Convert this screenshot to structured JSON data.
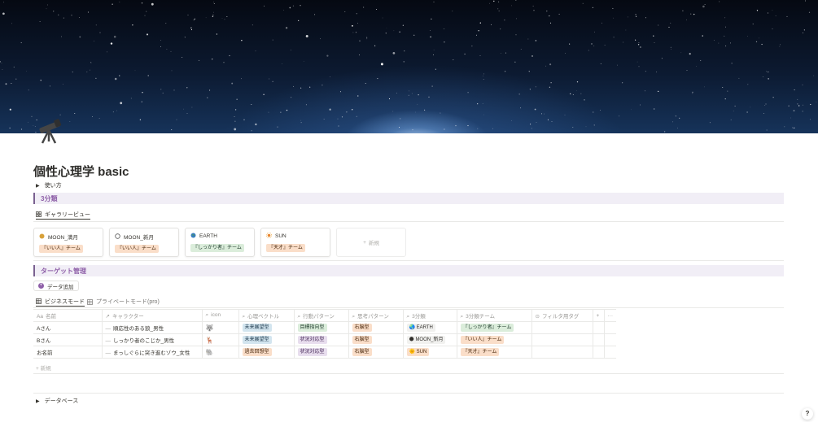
{
  "page": {
    "title": "個性心理学 basic",
    "icon": "telescope-icon"
  },
  "toggles": {
    "usage": "使い方",
    "database": "データベース"
  },
  "section1": {
    "heading": "3分類",
    "view_tab": "ギャラリービュー",
    "cards": [
      {
        "title": "MOON_満月",
        "icon": "full-moon-icon",
        "tag": "『いい人』チーム",
        "tag_color": "orange"
      },
      {
        "title": "MOON_新月",
        "icon": "new-moon-icon",
        "tag": "『いい人』チーム",
        "tag_color": "orange"
      },
      {
        "title": "EARTH",
        "icon": "earth-icon",
        "tag": "『しっかり者』チーム",
        "tag_color": "green"
      },
      {
        "title": "SUN",
        "icon": "sun-icon",
        "tag": "『天才』チーム",
        "tag_color": "orange"
      }
    ],
    "new_card": "新規"
  },
  "section2": {
    "heading": "ターゲット管理",
    "add_button": "データ追加",
    "tabs": [
      "ビジネスモード",
      "プライベートモード(pro)"
    ],
    "columns": [
      "名前",
      "キャラクター",
      "icon",
      "心理ベクトル",
      "行動パターン",
      "思考パターン",
      "3分類",
      "3分類チーム",
      "フィルタ用タグ"
    ],
    "column_icons": [
      "Aa",
      "↗",
      "⌕",
      "⌕",
      "⌕",
      "⌕",
      "⌕",
      "⌕",
      "⊙"
    ],
    "rows": [
      {
        "name": "Aさん",
        "character": "順応性のある狼_男性",
        "icon": "🐺",
        "vector": "未来展望型",
        "action": "目標指向型",
        "thinking": "右脳型",
        "class3": "EARTH",
        "team": "『しっかり者』チーム"
      },
      {
        "name": "Bさん",
        "character": "しっかり者のこじか_男性",
        "icon": "🦌",
        "vector": "未来展望型",
        "action": "状況対応型",
        "thinking": "右脳型",
        "class3": "MOON_新月",
        "team": "『いい人』チーム"
      },
      {
        "name": "お名前",
        "character": "まっしぐらに突き進むゾウ_女性",
        "icon": "🐘",
        "vector": "過去回想型",
        "action": "状況対応型",
        "thinking": "右脳型",
        "class3": "SUN",
        "team": "『天才』チーム"
      }
    ],
    "new_row": "新規",
    "header_extras": {
      "plus": "+",
      "more": "···"
    }
  },
  "help": "?",
  "colors": {
    "accent": "#8e5fa8",
    "callout_bg": "#f1eef6"
  }
}
